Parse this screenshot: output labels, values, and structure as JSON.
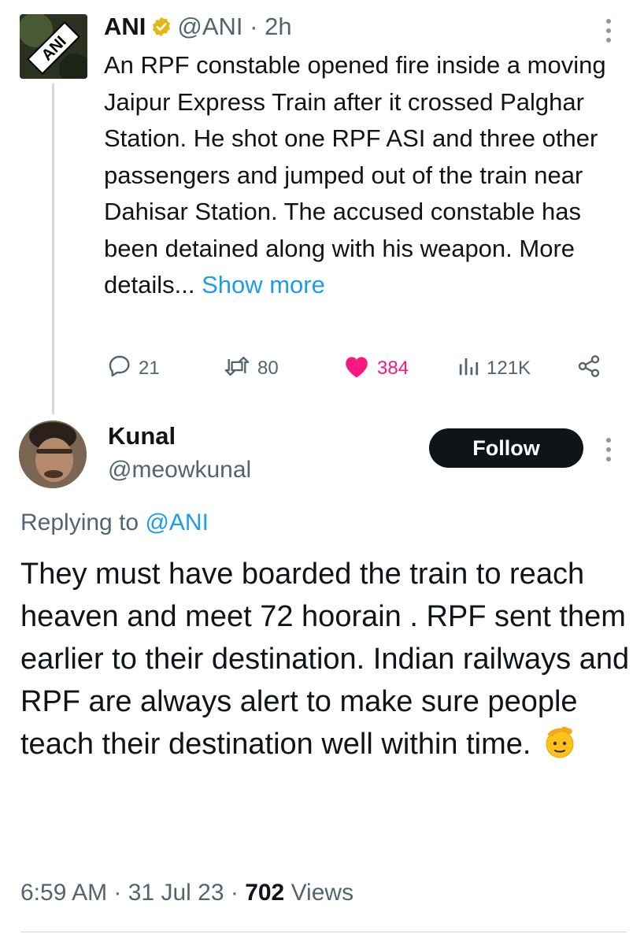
{
  "parent_tweet": {
    "name": "ANI",
    "handle": "@ANI",
    "time": "2h",
    "avatar_text": "ANI",
    "text": "An RPF constable opened fire inside a moving Jaipur Express Train after it crossed Palghar Station. He shot one RPF ASI and three other passengers and jumped out of the train near Dahisar Station. The accused constable has been detained along with his weapon. More details...",
    "show_more": "Show more",
    "stats": {
      "replies": "21",
      "retweets": "80",
      "likes": "384",
      "views": "121K"
    },
    "icons": [
      "verified-badge-icon",
      "reply-icon",
      "retweet-icon",
      "heart-icon",
      "views-icon",
      "share-icon",
      "more-dots-icon"
    ]
  },
  "reply": {
    "name": "Kunal",
    "handle": "@meowkunal",
    "follow_label": "Follow",
    "replying_prefix": "Replying to",
    "replying_to": "@ANI",
    "text": "They must have boarded the train to reach heaven and meet 72 hoorain . RPF sent them earlier to their destination. Indian railways and RPF are always alert to make sure people teach their destination well within time.",
    "emoji_icon": "saluting-face-icon",
    "timestamp": "6:59 AM",
    "date": "31 Jul 23",
    "views_count": "702",
    "views_label": "Views"
  },
  "colors": {
    "accent": "#1d9bf0",
    "like": "#f91880",
    "secondary_text": "#536471",
    "primary_text": "#0f1419",
    "verified_gold": "#e2b719"
  }
}
